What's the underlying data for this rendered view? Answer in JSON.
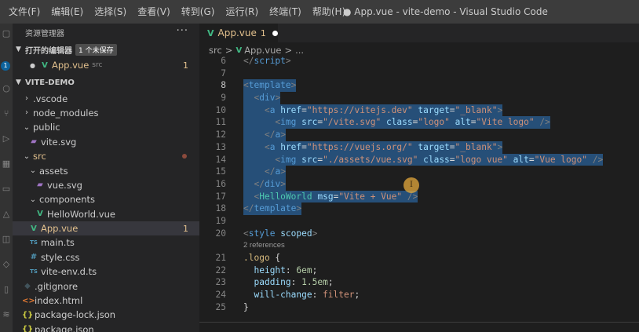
{
  "menu": [
    "文件(F)",
    "编辑(E)",
    "选择(S)",
    "查看(V)",
    "转到(G)",
    "运行(R)",
    "终端(T)",
    "帮助(H)"
  ],
  "window_title": "● App.vue - vite-demo - Visual Studio Code",
  "activity_badge": "1",
  "sidebar": {
    "title": "资源管理器",
    "more": "···",
    "open_editors": {
      "label": "打开的编辑器",
      "badge": "1 个未保存",
      "items": [
        {
          "name": "App.vue",
          "desc": "src",
          "count": "1"
        }
      ]
    },
    "project": {
      "label": "VITE-DEMO",
      "tree": [
        {
          "depth": 1,
          "kind": "folder",
          "open": false,
          "name": ".vscode"
        },
        {
          "depth": 1,
          "kind": "folder",
          "open": false,
          "name": "node_modules"
        },
        {
          "depth": 1,
          "kind": "folder",
          "open": true,
          "name": "public"
        },
        {
          "depth": 2,
          "kind": "svg",
          "name": "vite.svg"
        },
        {
          "depth": 1,
          "kind": "folder",
          "open": true,
          "name": "src",
          "modified": true,
          "dot": true
        },
        {
          "depth": 2,
          "kind": "folder",
          "open": true,
          "name": "assets"
        },
        {
          "depth": 3,
          "kind": "svg",
          "name": "vue.svg"
        },
        {
          "depth": 2,
          "kind": "folder",
          "open": true,
          "name": "components"
        },
        {
          "depth": 3,
          "kind": "vue",
          "name": "HelloWorld.vue"
        },
        {
          "depth": 2,
          "kind": "vue",
          "name": "App.vue",
          "modified": true,
          "selected": true,
          "count": "1"
        },
        {
          "depth": 2,
          "kind": "ts",
          "name": "main.ts"
        },
        {
          "depth": 2,
          "kind": "css",
          "name": "style.css"
        },
        {
          "depth": 2,
          "kind": "ts",
          "name": "vite-env.d.ts"
        },
        {
          "depth": 1,
          "kind": "git",
          "name": ".gitignore"
        },
        {
          "depth": 1,
          "kind": "html",
          "name": "index.html"
        },
        {
          "depth": 1,
          "kind": "json",
          "name": "package-lock.json"
        },
        {
          "depth": 1,
          "kind": "json",
          "name": "package.json"
        }
      ]
    }
  },
  "icons": {
    "vue": "V",
    "ts": "TS",
    "css": "#",
    "svg": "▰",
    "json": "{}",
    "html": "<>",
    "git": "◆"
  },
  "tab": {
    "name": "App.vue",
    "count": "1"
  },
  "breadcrumb": {
    "folder": "src",
    "file": "App.vue",
    "tail": "..."
  },
  "code_lines": [
    {
      "n": "6",
      "parts": [
        [
          "p",
          "</"
        ],
        [
          "tag",
          "script"
        ],
        [
          "p",
          ">"
        ]
      ]
    },
    {
      "n": "7",
      "parts": []
    },
    {
      "n": "8",
      "sel": true,
      "parts": [
        [
          "p",
          "<"
        ],
        [
          "tag",
          "template"
        ],
        [
          "p",
          ">"
        ]
      ]
    },
    {
      "n": "9",
      "sel": true,
      "parts": [
        [
          "t",
          "  "
        ],
        [
          "p",
          "<"
        ],
        [
          "tag",
          "div"
        ],
        [
          "p",
          ">"
        ]
      ]
    },
    {
      "n": "10",
      "sel": true,
      "parts": [
        [
          "t",
          "    "
        ],
        [
          "p",
          "<"
        ],
        [
          "tag",
          "a"
        ],
        [
          "t",
          " "
        ],
        [
          "attr",
          "href"
        ],
        [
          "t",
          "="
        ],
        [
          "str",
          "\"https://vitejs.dev\""
        ],
        [
          "t",
          " "
        ],
        [
          "attr",
          "target"
        ],
        [
          "t",
          "="
        ],
        [
          "str",
          "\"_blank\""
        ],
        [
          "p",
          ">"
        ]
      ]
    },
    {
      "n": "11",
      "sel": true,
      "parts": [
        [
          "t",
          "      "
        ],
        [
          "p",
          "<"
        ],
        [
          "tag",
          "img"
        ],
        [
          "t",
          " "
        ],
        [
          "attr",
          "src"
        ],
        [
          "t",
          "="
        ],
        [
          "str",
          "\"/vite.svg\""
        ],
        [
          "t",
          " "
        ],
        [
          "attr",
          "class"
        ],
        [
          "t",
          "="
        ],
        [
          "str",
          "\"logo\""
        ],
        [
          "t",
          " "
        ],
        [
          "attr",
          "alt"
        ],
        [
          "t",
          "="
        ],
        [
          "str",
          "\"Vite logo\""
        ],
        [
          "t",
          " "
        ],
        [
          "p",
          "/>"
        ]
      ]
    },
    {
      "n": "12",
      "sel": true,
      "parts": [
        [
          "t",
          "    "
        ],
        [
          "p",
          "</"
        ],
        [
          "tag",
          "a"
        ],
        [
          "p",
          ">"
        ]
      ]
    },
    {
      "n": "13",
      "sel": true,
      "parts": [
        [
          "t",
          "    "
        ],
        [
          "p",
          "<"
        ],
        [
          "tag",
          "a"
        ],
        [
          "t",
          " "
        ],
        [
          "attr",
          "href"
        ],
        [
          "t",
          "="
        ],
        [
          "str",
          "\"https://vuejs.org/\""
        ],
        [
          "t",
          " "
        ],
        [
          "attr",
          "target"
        ],
        [
          "t",
          "="
        ],
        [
          "str",
          "\"_blank\""
        ],
        [
          "p",
          ">"
        ]
      ]
    },
    {
      "n": "14",
      "sel": true,
      "parts": [
        [
          "t",
          "      "
        ],
        [
          "p",
          "<"
        ],
        [
          "tag",
          "img"
        ],
        [
          "t",
          " "
        ],
        [
          "attr",
          "src"
        ],
        [
          "t",
          "="
        ],
        [
          "str",
          "\"./assets/vue.svg\""
        ],
        [
          "t",
          " "
        ],
        [
          "attr",
          "class"
        ],
        [
          "t",
          "="
        ],
        [
          "str",
          "\"logo vue\""
        ],
        [
          "t",
          " "
        ],
        [
          "attr",
          "alt"
        ],
        [
          "t",
          "="
        ],
        [
          "str",
          "\"Vue logo\""
        ],
        [
          "t",
          " "
        ],
        [
          "p",
          "/>"
        ]
      ]
    },
    {
      "n": "15",
      "sel": true,
      "parts": [
        [
          "t",
          "    "
        ],
        [
          "p",
          "</"
        ],
        [
          "tag",
          "a"
        ],
        [
          "p",
          ">"
        ]
      ]
    },
    {
      "n": "16",
      "sel": true,
      "parts": [
        [
          "t",
          "  "
        ],
        [
          "p",
          "</"
        ],
        [
          "tag",
          "div"
        ],
        [
          "p",
          ">"
        ]
      ]
    },
    {
      "n": "17",
      "sel": true,
      "parts": [
        [
          "t",
          "  "
        ],
        [
          "p",
          "<"
        ],
        [
          "comp",
          "HelloWorld"
        ],
        [
          "t",
          " "
        ],
        [
          "attr",
          "msg"
        ],
        [
          "t",
          "="
        ],
        [
          "str",
          "\"Vite + Vue\""
        ],
        [
          "t",
          " "
        ],
        [
          "p",
          "/>"
        ]
      ]
    },
    {
      "n": "18",
      "sel": true,
      "parts": [
        [
          "p",
          "</"
        ],
        [
          "tag",
          "template"
        ],
        [
          "p",
          ">"
        ]
      ]
    },
    {
      "n": "19",
      "parts": []
    },
    {
      "n": "20",
      "parts": [
        [
          "p",
          "<"
        ],
        [
          "tag",
          "style"
        ],
        [
          "t",
          " "
        ],
        [
          "attr",
          "scoped"
        ],
        [
          "p",
          ">"
        ]
      ]
    },
    {
      "n": "",
      "refs": "2 references"
    },
    {
      "n": "21",
      "parts": [
        [
          "selector",
          ".logo"
        ],
        [
          "t",
          " {"
        ]
      ]
    },
    {
      "n": "22",
      "parts": [
        [
          "t",
          "  "
        ],
        [
          "prop",
          "height"
        ],
        [
          "t",
          ": "
        ],
        [
          "num",
          "6em"
        ],
        [
          "t",
          ";"
        ]
      ]
    },
    {
      "n": "23",
      "parts": [
        [
          "t",
          "  "
        ],
        [
          "prop",
          "padding"
        ],
        [
          "t",
          ": "
        ],
        [
          "num",
          "1.5em"
        ],
        [
          "t",
          ";"
        ]
      ]
    },
    {
      "n": "24",
      "parts": [
        [
          "t",
          "  "
        ],
        [
          "prop",
          "will-change"
        ],
        [
          "t",
          ": "
        ],
        [
          "val",
          "filter"
        ],
        [
          "t",
          ";"
        ]
      ]
    },
    {
      "n": "25",
      "parts": [
        [
          "t",
          "}"
        ]
      ]
    }
  ],
  "cursor_glyph": "I"
}
